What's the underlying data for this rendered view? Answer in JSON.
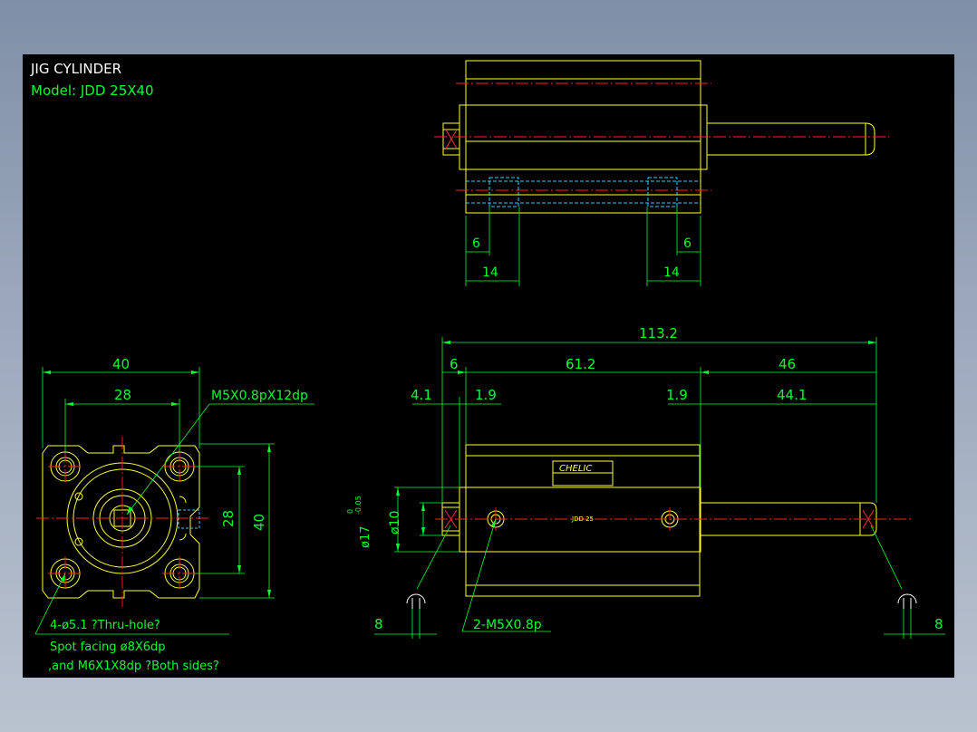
{
  "title": {
    "heading": "JIG CYLINDER",
    "model": "Model:  JDD  25X40"
  },
  "colors": {
    "background": "#000000",
    "outline": "#ffff33",
    "dimension": "#00ff33",
    "centerline": "#ff2020",
    "hidden": "#33ccff",
    "frame_bg": "#9aa7bb"
  },
  "top_view": {
    "dim_left_inner": "6",
    "dim_left_outer": "14",
    "dim_right_inner": "6",
    "dim_right_outer": "14"
  },
  "end_view": {
    "width_outer": "40",
    "width_inner": "28",
    "height_inner": "28",
    "height_outer": "40",
    "thread_callout": "M5X0.8pX12dp",
    "hole_callout": "4-ø5.1 ?Thru-hole?",
    "spot_facing": "Spot facing  ø8X6dp",
    "thread_note": ",and  M6X1X8dp ?Both sides?"
  },
  "front_view": {
    "overall": "113.2",
    "left_offset": "6",
    "body_length": "61.2",
    "rod_length": "46",
    "left_small": "4.1",
    "left_gap": "1.9",
    "right_gap": "1.9",
    "rod_extension": "44.1",
    "rod_dia": "ø10",
    "bore_dia": "ø17",
    "bore_tol_upper": "0",
    "bore_tol_lower": "-0.05",
    "port_callout": "2-M5X0.8p",
    "wrench_left": "8",
    "wrench_right": "8",
    "label_brand": "CHELIC",
    "label_model": "JDD 25"
  }
}
